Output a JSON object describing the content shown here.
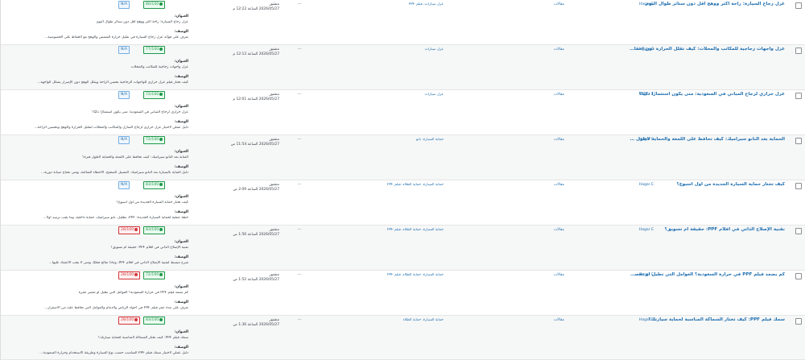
{
  "labels": {
    "title_label": "العنوان:",
    "desc_label": "الوصف:"
  },
  "rows": [
    {
      "title": "عزل زجاج السيارة: راحة أكثر ووهج أقل دون ستائر طوال اليوم",
      "author": "Hagar E",
      "category": "مقالات",
      "tags": "عزل سيارات، فيلم PPF",
      "comments": "—",
      "status": "منشور",
      "date": "2026/05/27 الساعة 12:22 م",
      "score1": "N/A",
      "score2": "80/100",
      "seo_title": "عزل زجاج السيارة: راحة أكثر ووهج أقل دون ستائر طوال اليوم",
      "seo_desc": "تعرف على فوائد عزل زجاج السيارة في تقليل حرارة الشمس والوهج مع الحفاظ على الخصوصية..."
    },
    {
      "title": "عزل واجهات زجاجية للمكاتب والمحلات: كيف تقلل الحرارة دون إخفاء الهوية؟",
      "author": "Hagar E",
      "category": "مقالات",
      "tags": "عزل سيارات",
      "comments": "—",
      "status": "منشور",
      "date": "2026/05/27 الساعة 12:12 م",
      "score1": "N/A",
      "score2": "77/100",
      "seo_title": "عزل واجهات زجاجية للمكاتب والمحلات",
      "seo_desc": "كيف تختار فيلم عزل حراري للواجهات الزجاجية يحسن الراحة ويقلل الوهج دون الإضرار بشكل الواجهة..."
    },
    {
      "title": "عزل حراري لزجاج المباني في السعودية: متى يكون استثمارًا ذكيًا؟",
      "author": "Hagar E",
      "category": "مقالات",
      "tags": "عزل سيارات",
      "comments": "—",
      "status": "منشور",
      "date": "2026/05/27 الساعة 12:01 م",
      "score1": "N/A",
      "score2": "72/100",
      "seo_title": "عزل حراري لزجاج المباني في السعودية: متى يكون استثمارًا ذكيًا؟",
      "seo_desc": "دليل عملي لاختيار عزل حراري لزجاج المنازل والمكاتب والمحلات لتقليل الحرارة والوهج وتحسين الراحة..."
    },
    {
      "title": "الحماية بعد النانو سيراميك: كيف تحافظ على اللمعة والحماية لأطول فترة؟",
      "author": "Hagar E",
      "category": "مقالات",
      "tags": "حماية السيارة، نانو",
      "comments": "—",
      "status": "منشور",
      "date": "2026/05/27 الساعة 11:54 ص",
      "score1": "N/A",
      "score2": "72/100",
      "seo_title": "العناية بعد النانو سيراميك: كيف تحافظ على اللمعة والحماية لأطول فترة؟",
      "seo_desc": "دليل العناية بالسيارة بعد النانو سيراميك: الغسيل الصحيح، الأخطاء الشائعة، ومتى تحتاج صيانة دورية..."
    },
    {
      "title": "كيف تختار حماية السيارة الجديدة من أول أسبوع؟",
      "author": "Hagar E",
      "category": "مقالات",
      "tags": "حماية السيارة، حماية الطلاء، فيلم PPF",
      "comments": "—",
      "status": "منشور",
      "date": "2026/05/27 الساعة 2:09 ص",
      "score1": "N/A",
      "score2": "83/100",
      "seo_title": "كيف تختار حماية السيارة الجديدة من أول أسبوع؟",
      "seo_desc": "خطة عملية لحماية السيارة الجديدة: PPF، تظليل، نانو سيراميك، حماية داخلية، وما يجب ترتيبه أولًا..."
    },
    {
      "title": "نقنية الإصلاح الذاتي في أفلام PPF: حقيقة أم تسويق؟",
      "author": "Hagar E",
      "category": "مقالات",
      "tags": "حماية السيارة، حماية الطلاء، فيلم PPF",
      "comments": "—",
      "status": "منشور",
      "date": "2026/05/27 الساعة 1:56 ص",
      "score1": "28/100",
      "score2": "83/100",
      "seo_title": "تقنية الإصلاح الذاتي في أفلام PPF: حقيقة أم تسويق؟",
      "seo_desc": "شرح مبسط لتقنية الإصلاح الذاتي في أفلام PPF، وماذا تعالج فعليًا، ومتى لا يجب الاعتماد عليها..."
    },
    {
      "title": "كم يصمد فيلم PPF في حرارة السعودية؟ العوامل التي تطيل أو تقصر عمره",
      "author": "Hagar E",
      "category": "مقالات",
      "tags": "حماية السيارة، حماية الطلاء، فيلم PPF",
      "comments": "—",
      "status": "منشور",
      "date": "2026/05/27 الساعة 1:52 ص",
      "score1": "28/100",
      "score2": "72/100",
      "seo_title": "كم يصمد فيلم PPF في حرارة السعودية؟ العوامل التي تطيل أو تقصر عمره",
      "seo_desc": "تعرف على مدة عمر فيلم PPF في أجواء الرياض والدمام والعوامل التي تحافظ عليه من الاصفرار..."
    },
    {
      "title": "سمك فيلم PPF: كيف تختار السماكة المناسبة لحماية سيارتك؟",
      "author": "Hagar E",
      "category": "مقالات",
      "tags": "حماية السيارة، حماية الطلاء",
      "comments": "—",
      "status": "منشور",
      "date": "2026/05/27 الساعة 1:36 ص",
      "score1": "28/100",
      "score2": "83/100",
      "seo_title": "سمك فيلم PPF: كيف تختار السماكة المناسبة لحماية سيارتك؟",
      "seo_desc": "دليل عملي لاختيار سمك فيلم PPF المناسب حسب نوع السيارة وطريقة الاستخدام وحرارة السعودية..."
    }
  ]
}
